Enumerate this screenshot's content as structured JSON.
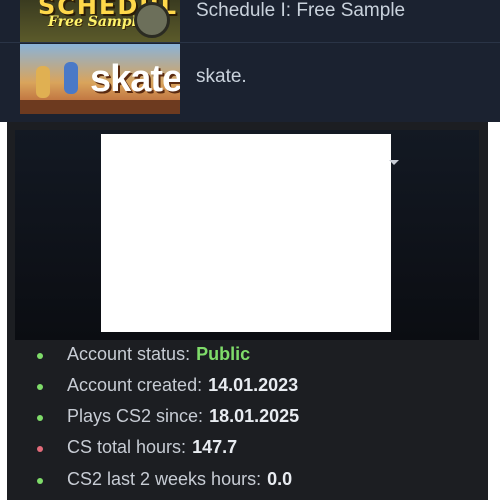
{
  "games": [
    {
      "title": "Schedule I: Free Sample",
      "thumb_text_main": "SCHEDULE",
      "thumb_text_sub": "Free Sample"
    },
    {
      "title": "skate.",
      "thumb_text_main": "skate."
    }
  ],
  "stats": [
    {
      "label": "Account status:",
      "value": "Public",
      "dot_color": "#7fdc6a",
      "value_color": "#7fdc6a"
    },
    {
      "label": "Account created:",
      "value": "14.01.2023",
      "dot_color": "#7fdc6a",
      "value_color": "#e8ecf1"
    },
    {
      "label": "Plays CS2 since:",
      "value": "18.01.2025",
      "dot_color": "#7fdc6a",
      "value_color": "#e8ecf1"
    },
    {
      "label": "CS total hours:",
      "value": "147.7",
      "dot_color": "#e36b7a",
      "value_color": "#e8ecf1"
    },
    {
      "label": "CS2 last 2 weeks hours:",
      "value": "0.0",
      "dot_color": "#7fdc6a",
      "value_color": "#e8ecf1"
    }
  ],
  "colors": {
    "background_top": "#1b2230",
    "card_background": "#1c1e22",
    "accent_green": "#7fdc6a",
    "accent_red": "#e36b7a"
  },
  "icons": {
    "dropdown": "chevron-down-icon",
    "bullet": "bullet-dot-icon"
  }
}
